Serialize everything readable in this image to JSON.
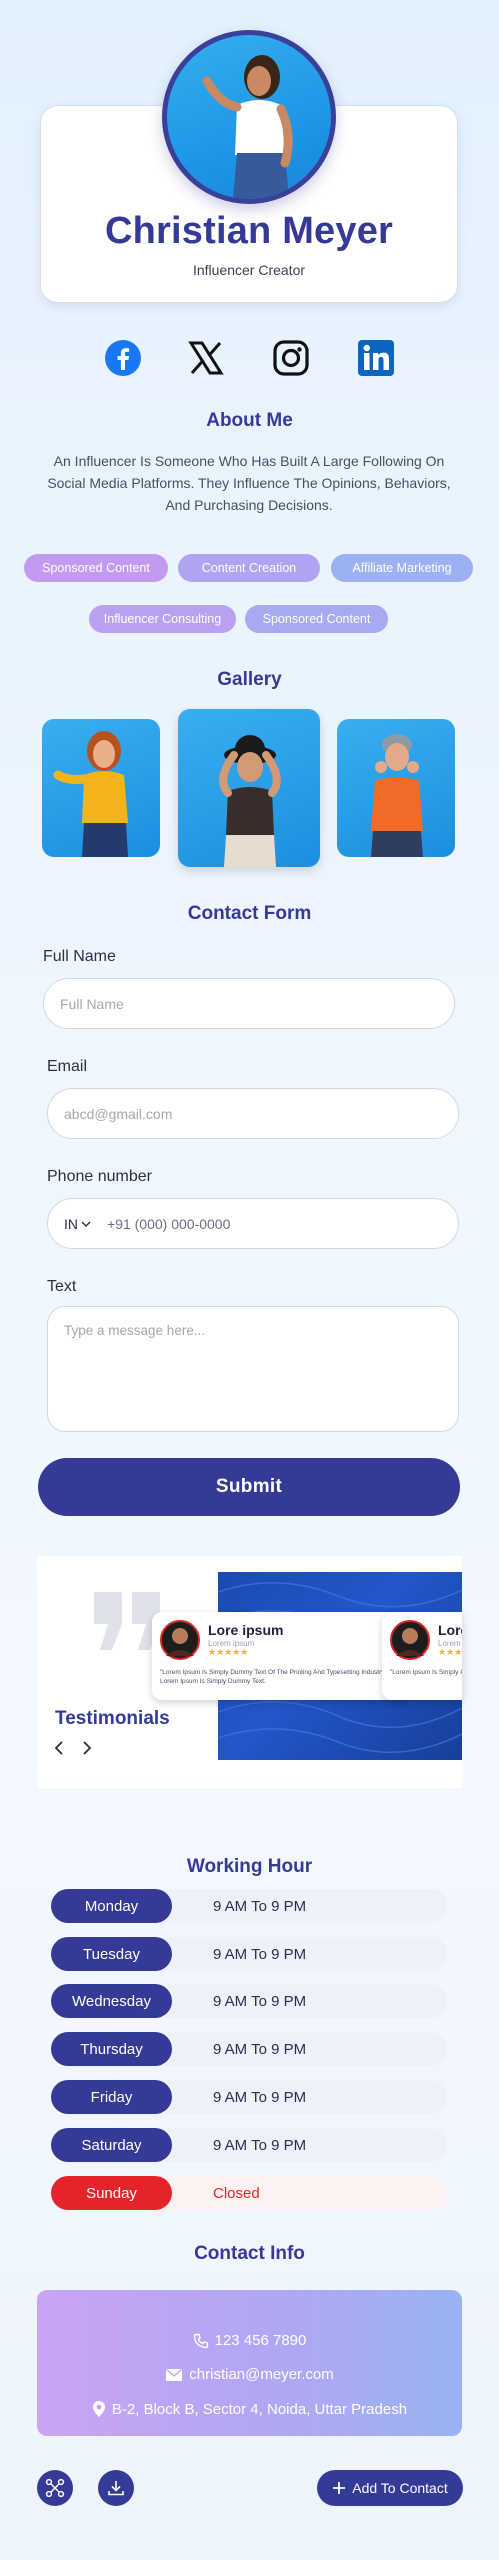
{
  "profile": {
    "name": "Christian Meyer",
    "role": "Influencer Creator"
  },
  "social": {
    "icons": [
      "facebook-icon",
      "x-icon",
      "instagram-icon",
      "linkedin-icon"
    ]
  },
  "about": {
    "title": "About Me",
    "text": "An Influencer Is Someone Who Has Built A Large Following On Social Media Platforms. They Influence The Opinions, Behaviors, And Purchasing Decisions."
  },
  "tags": [
    "Sponsored Content",
    "Content Creation",
    "Affiliate Marketing",
    "Influencer Consulting",
    "Sponsored Content"
  ],
  "gallery": {
    "title": "Gallery"
  },
  "contact_form": {
    "title": "Contact Form",
    "full_name_label": "Full Name",
    "full_name_placeholder": "Full Name",
    "email_label": "Email",
    "email_placeholder": "abcd@gmail.com",
    "phone_label": "Phone number",
    "phone_country": "IN",
    "phone_placeholder": "+91 (000) 000-0000",
    "text_label": "Text",
    "text_placeholder": "Type a message here...",
    "submit_label": "Submit"
  },
  "testimonials": {
    "title": "Testimonials",
    "cards": [
      {
        "name": "Lore ipsum",
        "subtitle": "Lorem ipsum",
        "stars": "★★★★★",
        "text": "\"Lorem Ipsum Is Simply Dummy Text Of The Printing And Typesetting Industry. Lorem Ipsum Is Simply Dummy Text."
      },
      {
        "name": "Lore",
        "subtitle": "Lorem",
        "stars": "★★★★",
        "text": "\"Lorem Ipsum Is Simply Industry. Lorem Ipsum Is"
      }
    ]
  },
  "working_hours": {
    "title": "Working Hour",
    "rows": [
      {
        "day": "Monday",
        "hours": "9 AM To 9 PM"
      },
      {
        "day": "Tuesday",
        "hours": "9 AM To 9 PM"
      },
      {
        "day": "Wednesday",
        "hours": "9 AM To 9 PM"
      },
      {
        "day": "Thursday",
        "hours": "9 AM To 9 PM"
      },
      {
        "day": "Friday",
        "hours": "9 AM To 9 PM"
      },
      {
        "day": "Saturday",
        "hours": "9 AM To 9 PM"
      },
      {
        "day": "Sunday",
        "hours": "Closed"
      }
    ]
  },
  "contact_info": {
    "title": "Contact Info",
    "phone": "123 456 7890",
    "email": "christian@meyer.com",
    "address": "B-2, Block B, Sector 4, Noida, Uttar Pradesh"
  },
  "footer": {
    "add_contact_label": "Add To Contact"
  },
  "colors": {
    "primary": "#343a96",
    "sunday": "#e5232a",
    "facebook": "#1877f2",
    "linkedin": "#0a66c2"
  }
}
